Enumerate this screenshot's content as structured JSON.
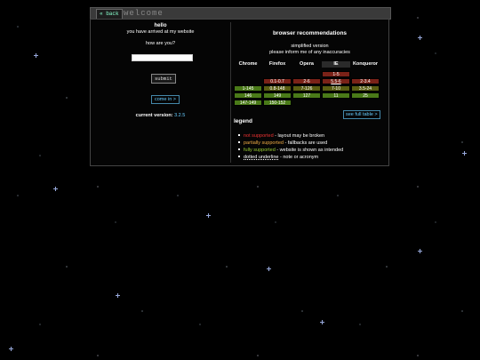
{
  "window": {
    "back_label": "« back",
    "title": "welcome"
  },
  "intro": {
    "hello": "hello",
    "arrived": "you have arrived at my website",
    "how_are_you": "how are you?",
    "input_value": "",
    "submit_label": "submit",
    "come_in_label": "come in >",
    "version_label": "current version:",
    "version_value": "3.2.5"
  },
  "recommendations": {
    "title": "browser recommendations",
    "subtitle1": "simplified version",
    "subtitle2": "please inform me of any inaccuracies",
    "headers": [
      "Chrome",
      "Firefox",
      "Opera",
      "IE",
      "Konqueror"
    ],
    "rows": [
      [
        null,
        null,
        null,
        {
          "text": "1-5",
          "status": "red"
        },
        null
      ],
      [
        null,
        {
          "text": "0.1-0.7",
          "status": "red"
        },
        {
          "text": "2-6",
          "status": "red"
        },
        {
          "text": "5.5-6",
          "status": "red"
        },
        {
          "text": "2-3.4",
          "status": "red"
        }
      ],
      [
        {
          "text": "1-145",
          "status": "green"
        },
        {
          "text": "0.8-148",
          "status": "olive"
        },
        {
          "text": "7-126",
          "status": "olive"
        },
        {
          "text": "7-10",
          "status": "olive"
        },
        {
          "text": "3.5-24",
          "status": "olive"
        }
      ],
      [
        {
          "text": "146",
          "status": "green"
        },
        {
          "text": "149",
          "status": "green"
        },
        {
          "text": "127",
          "status": "green"
        },
        {
          "text": "11",
          "status": "green"
        },
        {
          "text": "25",
          "status": "green"
        }
      ],
      [
        {
          "text": "147-149",
          "status": "green"
        },
        {
          "text": "150-152",
          "status": "green"
        },
        null,
        null,
        null
      ]
    ],
    "full_table_label": "see full table >"
  },
  "legend": {
    "title": "legend",
    "items": [
      {
        "term": "not supported",
        "desc": " - layout may be broken",
        "color": "red"
      },
      {
        "term": "partially supported",
        "desc": " - fallbacks are used",
        "color": "orange"
      },
      {
        "term": "fully supported",
        "desc": " - website is shown as intended",
        "color": "green"
      },
      {
        "term": "dotted underline",
        "desc": " - note or acronym",
        "color": "white"
      }
    ]
  },
  "colors": {
    "red": "#7a2218",
    "olive": "#5a5e12",
    "green": "#4a7a18",
    "accent": "#66ccff"
  }
}
